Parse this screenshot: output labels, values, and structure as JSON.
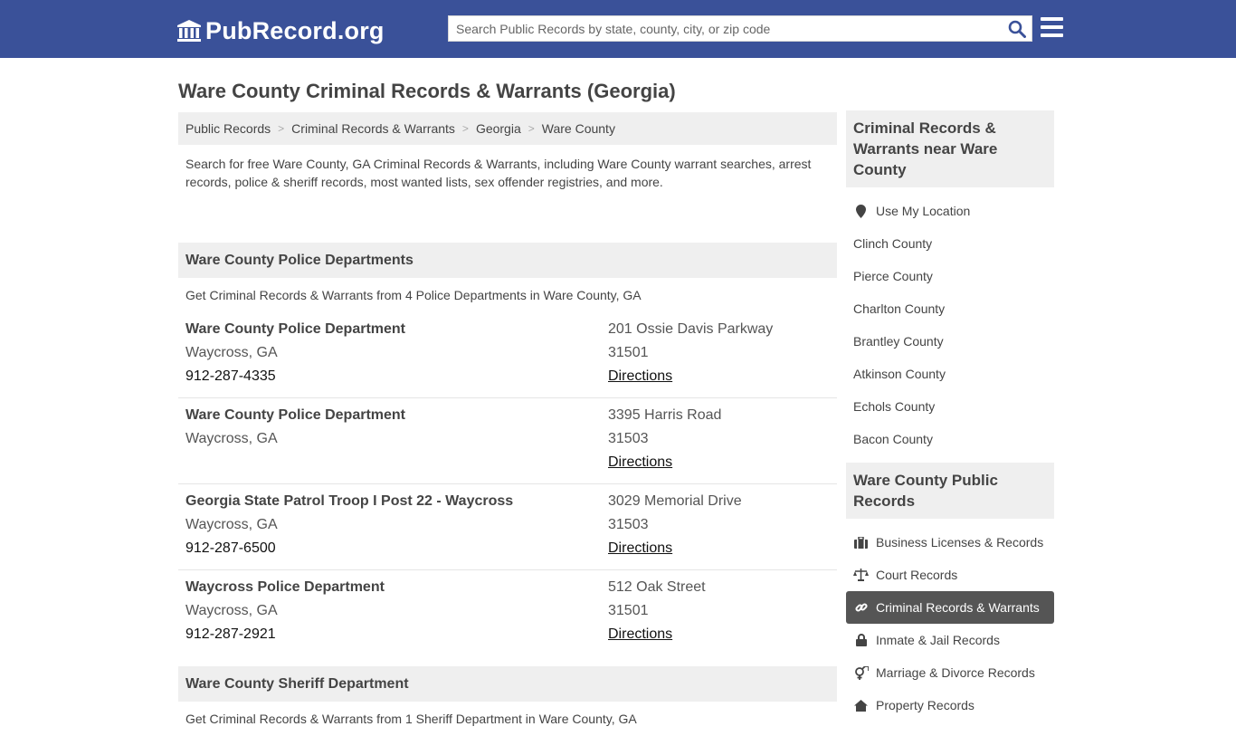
{
  "header": {
    "logo_text": "PubRecord.org",
    "search_placeholder": "Search Public Records by state, county, city, or zip code"
  },
  "page_title": "Ware County Criminal Records & Warrants (Georgia)",
  "breadcrumb": [
    "Public Records",
    "Criminal Records & Warrants",
    "Georgia",
    "Ware County"
  ],
  "intro": "Search for free Ware County, GA Criminal Records & Warrants, including Ware County warrant searches, arrest records, police & sheriff records, most wanted lists, sex offender registries, and more.",
  "police_section": {
    "title": "Ware County Police Departments",
    "subtitle": "Get Criminal Records & Warrants from 4 Police Departments in Ware County, GA",
    "departments": [
      {
        "name": "Ware County Police Department",
        "city": "Waycross, GA",
        "phone": "912-287-4335",
        "address": "201 Ossie Davis Parkway",
        "zip": "31501",
        "directions": "Directions"
      },
      {
        "name": "Ware County Police Department",
        "city": "Waycross, GA",
        "phone": "",
        "address": "3395 Harris Road",
        "zip": "31503",
        "directions": "Directions"
      },
      {
        "name": "Georgia State Patrol Troop I Post 22 - Waycross",
        "city": "Waycross, GA",
        "phone": "912-287-6500",
        "address": "3029 Memorial Drive",
        "zip": "31503",
        "directions": "Directions"
      },
      {
        "name": "Waycross Police Department",
        "city": "Waycross, GA",
        "phone": "912-287-2921",
        "address": "512 Oak Street",
        "zip": "31501",
        "directions": "Directions"
      }
    ]
  },
  "sheriff_section": {
    "title": "Ware County Sheriff Department",
    "subtitle": "Get Criminal Records & Warrants from 1 Sheriff Department in Ware County, GA"
  },
  "sidebar": {
    "nearby_title": "Criminal Records & Warrants near Ware County",
    "use_location": "Use My Location",
    "nearby": [
      "Clinch County",
      "Pierce County",
      "Charlton County",
      "Brantley County",
      "Atkinson County",
      "Echols County",
      "Bacon County"
    ],
    "public_title": "Ware County Public Records",
    "public_records": [
      {
        "label": "Business Licenses & Records",
        "icon": "briefcase-icon",
        "active": false
      },
      {
        "label": "Court Records",
        "icon": "scales-icon",
        "active": false
      },
      {
        "label": "Criminal Records & Warrants",
        "icon": "link-icon",
        "active": true
      },
      {
        "label": "Inmate & Jail Records",
        "icon": "lock-icon",
        "active": false
      },
      {
        "label": "Marriage & Divorce Records",
        "icon": "venus-mars-icon",
        "active": false
      },
      {
        "label": "Property Records",
        "icon": "home-icon",
        "active": false
      }
    ]
  },
  "colors": {
    "header_bg": "#3a5199",
    "panel_bg": "#efefef",
    "active_bg": "#555555"
  }
}
